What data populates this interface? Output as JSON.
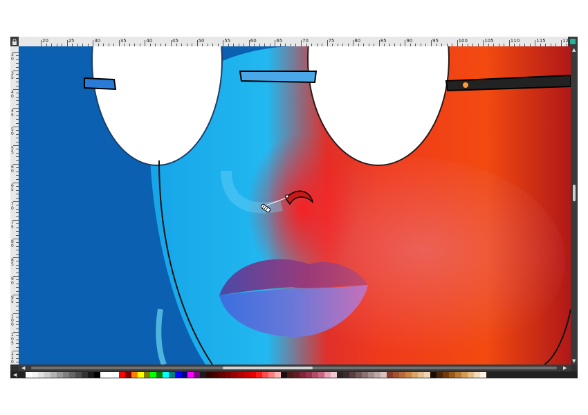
{
  "ruler": {
    "horizontal_labels": [
      "20",
      "25",
      "30",
      "35",
      "40",
      "45",
      "50",
      "55",
      "60",
      "65",
      "70",
      "75",
      "80",
      "85",
      "90",
      "95",
      "100",
      "105",
      "110",
      "115",
      "120"
    ],
    "vertical_labels": [
      "30",
      "35",
      "40",
      "45",
      "50",
      "55",
      "60",
      "65",
      "70",
      "75",
      "80",
      "85",
      "90",
      "95",
      "100",
      "105",
      "110"
    ]
  },
  "palette": {
    "swatches": [
      "#ffffff",
      "#f2f2f2",
      "#e0e0e0",
      "#cccccc",
      "#b3b3b3",
      "#999999",
      "#808080",
      "#666666",
      "#4d4d4d",
      "#333333",
      "#1a1a1a",
      "#000000",
      "#ffffff",
      "#ffffff",
      "#ffffff",
      "#ff0000",
      "#800000",
      "#ff8000",
      "#ffff00",
      "#808000",
      "#00ff00",
      "#008000",
      "#00ffff",
      "#008080",
      "#0000ff",
      "#000080",
      "#ff00ff",
      "#800080",
      "#1a1a1a",
      "#330000",
      "#4d0000",
      "#660000",
      "#800000",
      "#990000",
      "#b30000",
      "#cc0000",
      "#e60000",
      "#ff1a1a",
      "#ff4d4d",
      "#ff8080",
      "#ffb3b3",
      "#1a0d0d",
      "#4d1a1a",
      "#661a26",
      "#80263a",
      "#99334d",
      "#b34d66",
      "#cc6680",
      "#e6a0b3",
      "#f0c8d2",
      "#262626",
      "#3d2b2b",
      "#5a4040",
      "#735959",
      "#8c7373",
      "#a68c8c",
      "#bfa6a6",
      "#d9c2c2",
      "#8a3b2a",
      "#a0522d",
      "#b8693f",
      "#cd853f",
      "#daa56b",
      "#e6bf8f",
      "#f0d5b0",
      "#1a0d05",
      "#4d2608",
      "#733a0d",
      "#995a1a",
      "#b87a33",
      "#d19a55",
      "#e6bb80",
      "#f2d9b8",
      "#fff0e0"
    ]
  }
}
